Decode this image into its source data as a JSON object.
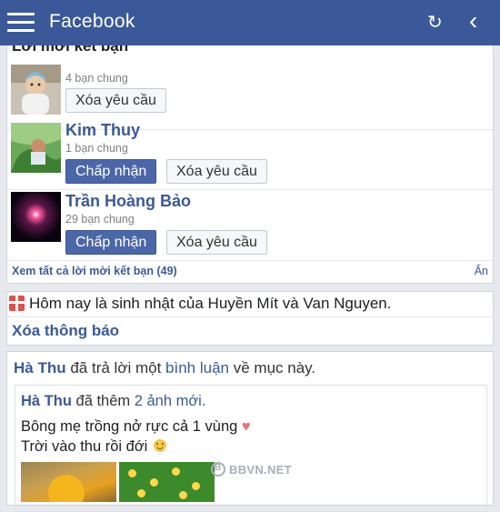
{
  "header": {
    "title": "Facebook",
    "menu_icon": "hamburger-menu-icon",
    "refresh_icon": "refresh-icon",
    "back_icon": "chevron-left-icon",
    "brand_color": "#3b5998"
  },
  "friend_requests": {
    "title": "Lời mời kết bạn",
    "items": [
      {
        "name": "",
        "mutual": "4 bạn chung",
        "confirm_label": "",
        "delete_label": "Xóa yêu cầu"
      },
      {
        "name": "Kim Thuy",
        "mutual": "1 bạn chung",
        "confirm_label": "Chấp nhận",
        "delete_label": "Xóa yêu cầu"
      },
      {
        "name": "Trần Hoàng Bảo",
        "mutual": "29 bạn chung",
        "confirm_label": "Chấp nhận",
        "delete_label": "Xóa yêu cầu"
      }
    ],
    "see_all": "Xem tất cả lời mời kết bạn (49)",
    "hide": "Ẩn"
  },
  "birthday": {
    "icon": "gift-icon",
    "text": "Hôm nay là sinh nhật của Huyền Mít và Van Nguyen.",
    "dismiss": "Xóa thông báo"
  },
  "post": {
    "actor": "Hà Thu",
    "action_pre": "đã trả lời một",
    "action_link": "bình luận",
    "action_post": "về mục này.",
    "inner": {
      "actor": "Hà Thu",
      "action_pre": "đã thêm",
      "action_link": "2 ảnh mới",
      "action_post": ".",
      "line1": "Bông mẹ trồng nở rực cả 1 vùng",
      "line1_icon": "heart-icon",
      "line2": "Trời vào thu rồi đới",
      "line2_icon": "smile-icon"
    }
  },
  "watermark": "BBVN.NET"
}
